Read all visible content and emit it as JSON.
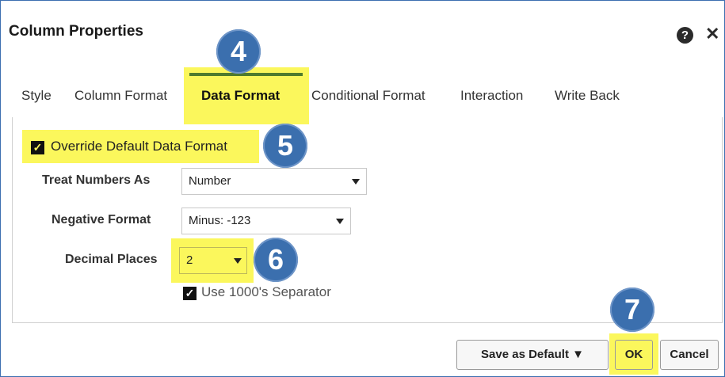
{
  "dialog": {
    "title": "Column Properties",
    "help_glyph": "?",
    "close_glyph": "✕"
  },
  "tabs": [
    {
      "label": "Style",
      "active": false
    },
    {
      "label": "Column Format",
      "active": false
    },
    {
      "label": "Data Format",
      "active": true
    },
    {
      "label": "Conditional Format",
      "active": false
    },
    {
      "label": "Interaction",
      "active": false
    },
    {
      "label": "Write Back",
      "active": false
    }
  ],
  "form": {
    "override": {
      "label": "Override Default Data Format",
      "checked": true
    },
    "treat_numbers_as": {
      "label": "Treat Numbers As",
      "value": "Number"
    },
    "negative_format": {
      "label": "Negative Format",
      "value": "Minus: -123"
    },
    "decimal_places": {
      "label": "Decimal Places",
      "value": "2"
    },
    "separator": {
      "label": "Use 1000's Separator",
      "checked": true
    },
    "check_glyph": "✓"
  },
  "callouts": [
    "4",
    "5",
    "6",
    "7"
  ],
  "footer": {
    "save_default": "Save as Default ▼",
    "ok": "OK",
    "cancel": "Cancel"
  },
  "colors": {
    "highlight": "#fbf75c",
    "callout": "#3b6fae",
    "active_tab_border": "#4f7b2d"
  }
}
